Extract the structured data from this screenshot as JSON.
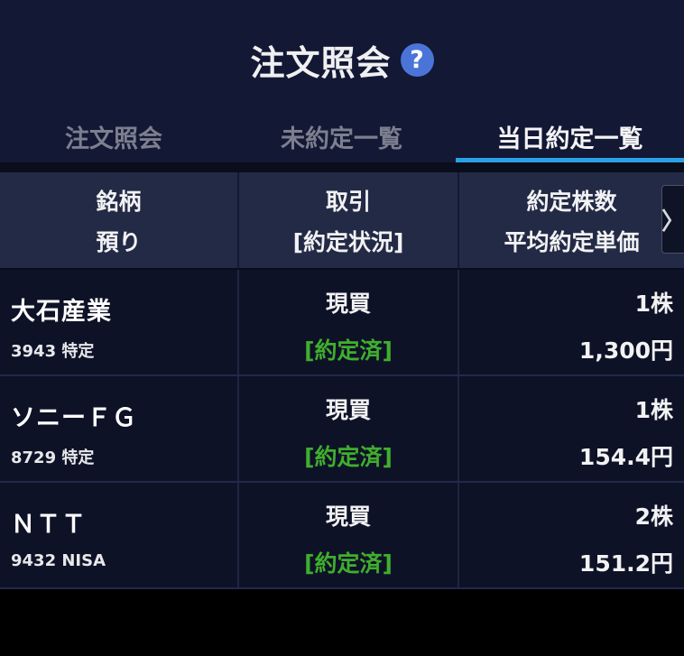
{
  "header": {
    "title": "注文照会",
    "help_icon": "question-circle-icon"
  },
  "tabs": [
    {
      "label": "注文照会",
      "active": false
    },
    {
      "label": "未約定一覧",
      "active": false
    },
    {
      "label": "当日約定一覧",
      "active": true
    }
  ],
  "table": {
    "headers": {
      "col1": {
        "line1": "銘柄",
        "line2": "預り"
      },
      "col2": {
        "line1": "取引",
        "line2": "[約定状況]"
      },
      "col3": {
        "line1": "約定株数",
        "line2": "平均約定単価"
      }
    },
    "scroll_icon": "chevron-right-icon",
    "rows": [
      {
        "name": "大石産業",
        "sub": "3943 特定",
        "trade": "現買",
        "status": "[約定済]",
        "qty": "1株",
        "price": "1,300円"
      },
      {
        "name": "ソニーＦＧ",
        "sub": "8729 特定",
        "trade": "現買",
        "status": "[約定済]",
        "qty": "1株",
        "price": "154.4円"
      },
      {
        "name": "ＮＴＴ",
        "sub": "9432 NISA",
        "trade": "現買",
        "status": "[約定済]",
        "qty": "2株",
        "price": "151.2円"
      }
    ]
  },
  "colors": {
    "background": "#131834",
    "accent": "#2aa0e6",
    "help": "#4a74d8",
    "status_done": "#3fae2e"
  }
}
